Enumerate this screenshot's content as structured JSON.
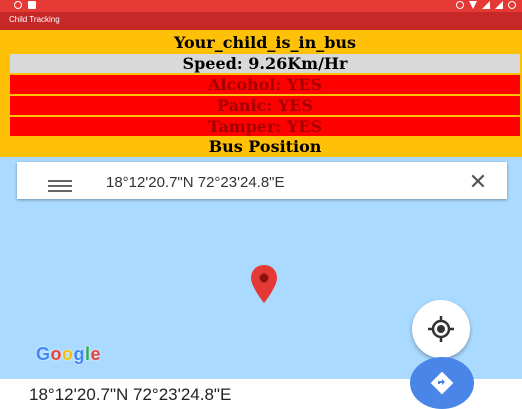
{
  "app": {
    "title": "Child Tracking"
  },
  "status": {
    "child_status": "Your_child_is_in_bus",
    "speed": "Speed: 9.26Km/Hr",
    "alcohol": "Alcohol: YES",
    "panic": "Panic: YES",
    "tamper": "Tamper: YES",
    "bus_position": "Bus Position"
  },
  "map": {
    "search_text": "18°12'20.7\"N 72°23'24.8\"E",
    "brand": [
      "G",
      "o",
      "o",
      "g",
      "l",
      "e"
    ],
    "brand_colors": [
      "#4285F4",
      "#EA4335",
      "#FBBC05",
      "#4285F4",
      "#34A853",
      "#EA4335"
    ],
    "background_color": "#aadaff",
    "pin_color": "#e53935"
  },
  "footer": {
    "coordinates": "18°12'20.7\"N 72°23'24.8\"E"
  },
  "icons": [
    "menu-icon",
    "close-icon",
    "map-pin-icon",
    "my-location-icon",
    "directions-icon"
  ],
  "colors": {
    "status_bar": "#e53935",
    "title_bar": "#c62828",
    "panel": "#ffc107",
    "alert_row": "#ff0000",
    "info_row": "#d9d9d9",
    "action_button": "#4a86e8"
  }
}
